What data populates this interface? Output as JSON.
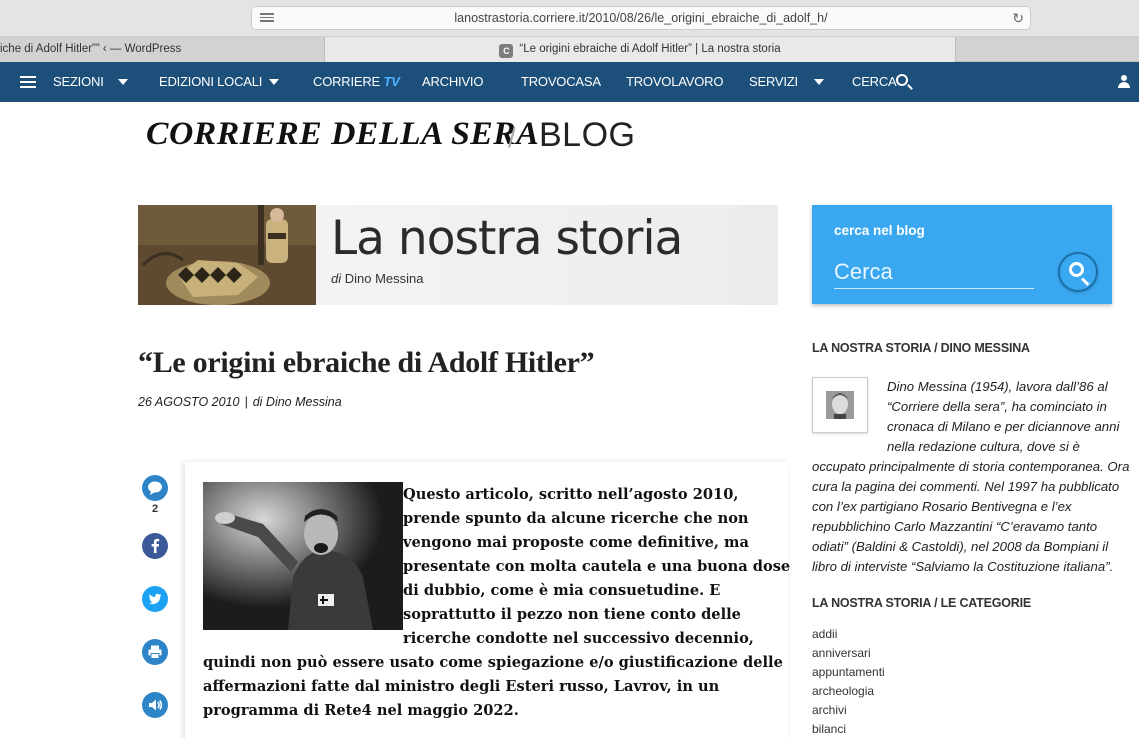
{
  "browser": {
    "url": "lanostrastoria.corriere.it/2010/08/26/le_origini_ebraiche_di_adolf_h/",
    "tabs": [
      {
        "label": "iche di Adolf Hitler”” ‹ — WordPress",
        "active": false
      },
      {
        "label": "“Le origini ebraiche di Adolf Hitler” | La nostra storia",
        "favicon": "C",
        "active": true
      }
    ]
  },
  "nav": {
    "sezioni": "SEZIONI",
    "edizioni": "EDIZIONI LOCALI",
    "corriere": "CORRIERE",
    "tv": "TV",
    "archivio": "ARCHIVIO",
    "trovocasa": "TROVOCASA",
    "trovolavoro": "TROVOLAVORO",
    "servizi": "SERVIZI",
    "cerca": "CERCA"
  },
  "masthead": {
    "brand": "CORRIERE DELLA SERA",
    "separator": "/",
    "blog": "BLOG"
  },
  "banner": {
    "title": "La nostra storia",
    "by": "di",
    "author": "Dino Messina"
  },
  "article": {
    "title": "“Le origini ebraiche di Adolf Hitler”",
    "date": "26 AGOSTO 2010",
    "meta_sep": "|",
    "by": "di",
    "author": "Dino Messina",
    "comment_count": "2",
    "body_lines": [
      "Questo articolo, scritto nell’agosto 2010,",
      "prende spunto da alcune ricerche che non",
      "vengono mai proposte come definitive, ma",
      "presentate con molta cautela e una buona dose",
      "di dubbio, come è mia consuetudine. E",
      "soprattutto il pezzo non tiene conto delle",
      "ricerche condotte nel successivo decennio,",
      "quindi non può essere usato come spiegazione e/o giustificazione delle",
      "affermazioni fatte dal ministro degli Esteri russo, Lavrov, in un",
      "programma di Rete4 nel maggio 2022."
    ]
  },
  "share_icons": [
    "comment-icon",
    "facebook-icon",
    "twitter-icon",
    "print-icon",
    "audio-icon"
  ],
  "sidebar": {
    "search_label": "cerca nel blog",
    "search_placeholder": "Cerca",
    "author_heading": "LA NOSTRA STORIA / DINO MESSINA",
    "bio_lines": [
      "Dino Messina (1954), lavora dall’86 al",
      "“Corriere della sera”, ha cominciato in",
      "cronaca di Milano e per diciannove anni",
      "nella redazione cultura, dove si è",
      "occupato principalmente di storia contemporanea. Ora",
      "cura la pagina dei commenti. Nel 1997 ha pubblicato",
      "con l’ex partigiano Rosario Bentivegna e l’ex",
      "repubblichino Carlo Mazzantini “C’eravamo tanto",
      "odiati” (Baldini & Castoldi), nel 2008 da Bompiani il",
      "libro di interviste “Salviamo la Costituzione italiana”."
    ],
    "categories_heading": "LA NOSTRA STORIA / LE CATEGORIE",
    "categories": [
      "addii",
      "anniversari",
      "appuntamenti",
      "archeologia",
      "archivi",
      "bilanci"
    ]
  },
  "colors": {
    "nav_bg": "#1d4f7b",
    "accent_blue": "#3aa8f1",
    "share_blue": "#2d84c7",
    "tv_blue": "#4fb3ff"
  }
}
